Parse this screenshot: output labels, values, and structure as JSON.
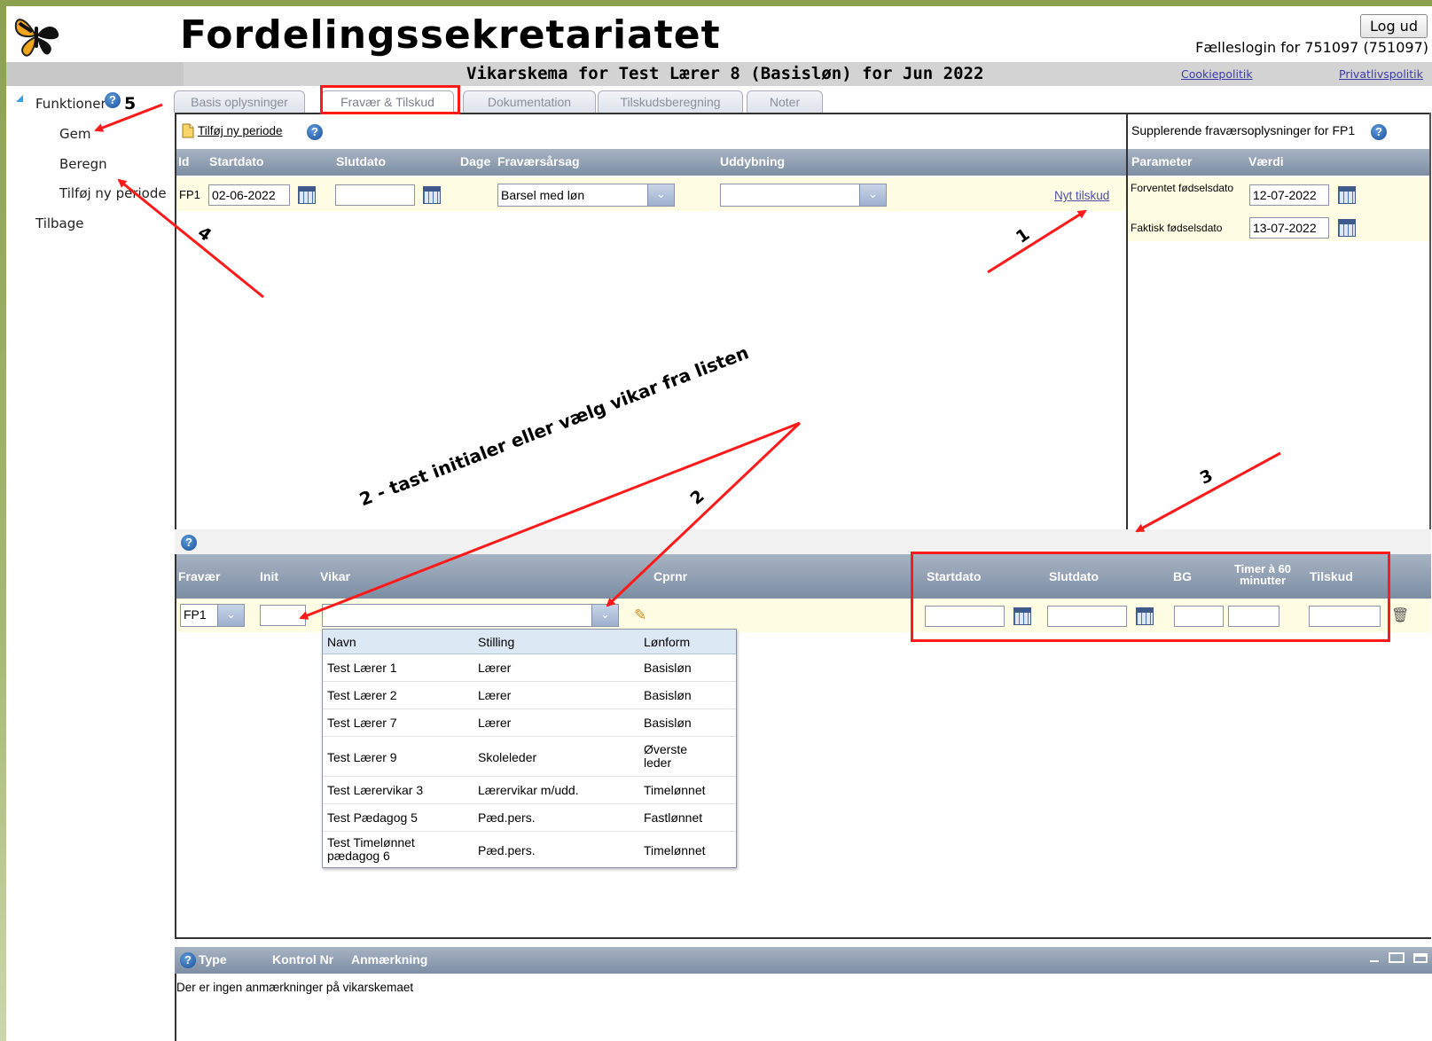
{
  "header": {
    "title": "Fordelingssekretariatet",
    "logout_label": "Log ud",
    "login_info": "Fælleslogin for 751097 (751097)",
    "subtitle": "Vikarskema for Test Lærer 8 (Basisløn) for Jun 2022",
    "cookie_link": "Cookiepolitik",
    "privacy_link": "Privatlivspolitik"
  },
  "sidebar": {
    "section_label": "Funktioner",
    "items": [
      {
        "label": "Gem"
      },
      {
        "label": "Beregn"
      },
      {
        "label": "Tilføj ny periode"
      }
    ],
    "back_label": "Tilbage"
  },
  "tabs": [
    {
      "label": "Basis oplysninger",
      "active": false
    },
    {
      "label": "Fravær & Tilskud",
      "active": true
    },
    {
      "label": "Dokumentation",
      "active": false
    },
    {
      "label": "Tilskudsberegning",
      "active": false
    },
    {
      "label": "Noter",
      "active": false
    }
  ],
  "period_panel": {
    "add_period_label": "Tilføj ny periode",
    "columns": [
      "Id",
      "Startdato",
      "Slutdato",
      "Dage",
      "Fraværsårsag",
      "Uddybning"
    ],
    "row": {
      "id": "FP1",
      "start": "02-06-2022",
      "end": "",
      "reason": "Barsel med løn",
      "detail": "",
      "new_grant_link": "Nyt tilskud"
    }
  },
  "supplement_panel": {
    "title": "Supplerende fraværsoplysninger for FP1",
    "columns": [
      "Parameter",
      "Værdi"
    ],
    "rows": [
      {
        "param": "Forventet fødselsdato",
        "value": "12-07-2022"
      },
      {
        "param": "Faktisk fødselsdato",
        "value": "13-07-2022"
      }
    ]
  },
  "substitute_panel": {
    "columns": [
      "Fravær",
      "Init",
      "Vikar",
      "Cprnr",
      "Startdato",
      "Slutdato",
      "BG",
      "Timer à 60 minutter",
      "Tilskud"
    ],
    "row": {
      "absence": "FP1",
      "init": "",
      "vikar": "",
      "start": "",
      "end": "",
      "bg": "",
      "hours": "",
      "grant": ""
    },
    "dropdown": {
      "columns": [
        "Navn",
        "Stilling",
        "Lønform"
      ],
      "rows": [
        {
          "name": "Test Lærer 1",
          "position": "Lærer",
          "pay": "Basisløn"
        },
        {
          "name": "Test Lærer 2",
          "position": "Lærer",
          "pay": "Basisløn"
        },
        {
          "name": "Test Lærer 7",
          "position": "Lærer",
          "pay": "Basisløn"
        },
        {
          "name": "Test Lærer 9",
          "position": "Skoleleder",
          "pay": "Øverste leder"
        },
        {
          "name": "Test Lærervikar 3",
          "position": "Lærervikar m/udd.",
          "pay": "Timelønnet"
        },
        {
          "name": "Test Pædagog 5",
          "position": "Pæd.pers.",
          "pay": "Fastlønnet"
        },
        {
          "name": "Test Timelønnet pædagog 6",
          "position": "Pæd.pers.",
          "pay": "Timelønnet"
        }
      ]
    }
  },
  "notes_panel": {
    "columns": [
      "Type",
      "Kontrol Nr",
      "Anmærkning"
    ],
    "empty_text": "Der er ingen anmærkninger på vikarskemaet"
  },
  "annotations": {
    "n1": "1",
    "n2": "2",
    "n3": "3",
    "n4": "4",
    "n5": "5",
    "instruction": "2 - tast initialer eller vælg vikar fra listen",
    "color": "#ff1a1a"
  },
  "icons": {
    "help": "?",
    "dropdown": "⌄",
    "pencil": "✎",
    "trash": "🗑"
  }
}
